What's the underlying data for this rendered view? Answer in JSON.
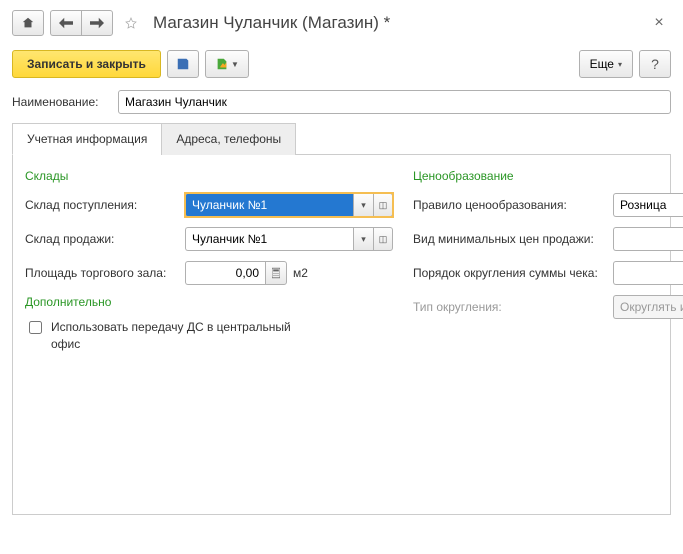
{
  "window": {
    "title": "Магазин Чуланчик (Магазин) *"
  },
  "toolbar": {
    "save_close": "Записать и закрыть",
    "more": "Еще"
  },
  "form": {
    "name_label": "Наименование:",
    "name_value": "Магазин Чуланчик"
  },
  "tabs": {
    "tab1": "Учетная информация",
    "tab2": "Адреса, телефоны"
  },
  "sections": {
    "warehouses": "Склады",
    "pricing": "Ценообразование",
    "additional": "Дополнительно"
  },
  "fields": {
    "receipt_warehouse_label": "Склад поступления:",
    "receipt_warehouse_value": "Чуланчик №1",
    "sale_warehouse_label": "Склад продажи:",
    "sale_warehouse_value": "Чуланчик №1",
    "area_label": "Площадь торгового зала:",
    "area_value": "0,00",
    "area_unit": "м2",
    "pricing_rule_label": "Правило ценообразования:",
    "pricing_rule_value": "Розница",
    "min_price_label": "Вид минимальных цен продажи:",
    "min_price_value": "",
    "rounding_order_label": "Порядок округления суммы чека:",
    "rounding_order_value": "",
    "rounding_type_label": "Тип округления:",
    "rounding_type_value": "Округлять итоговую сумму",
    "transfer_checkbox_label": "Использовать передачу ДС в центральный офис"
  }
}
